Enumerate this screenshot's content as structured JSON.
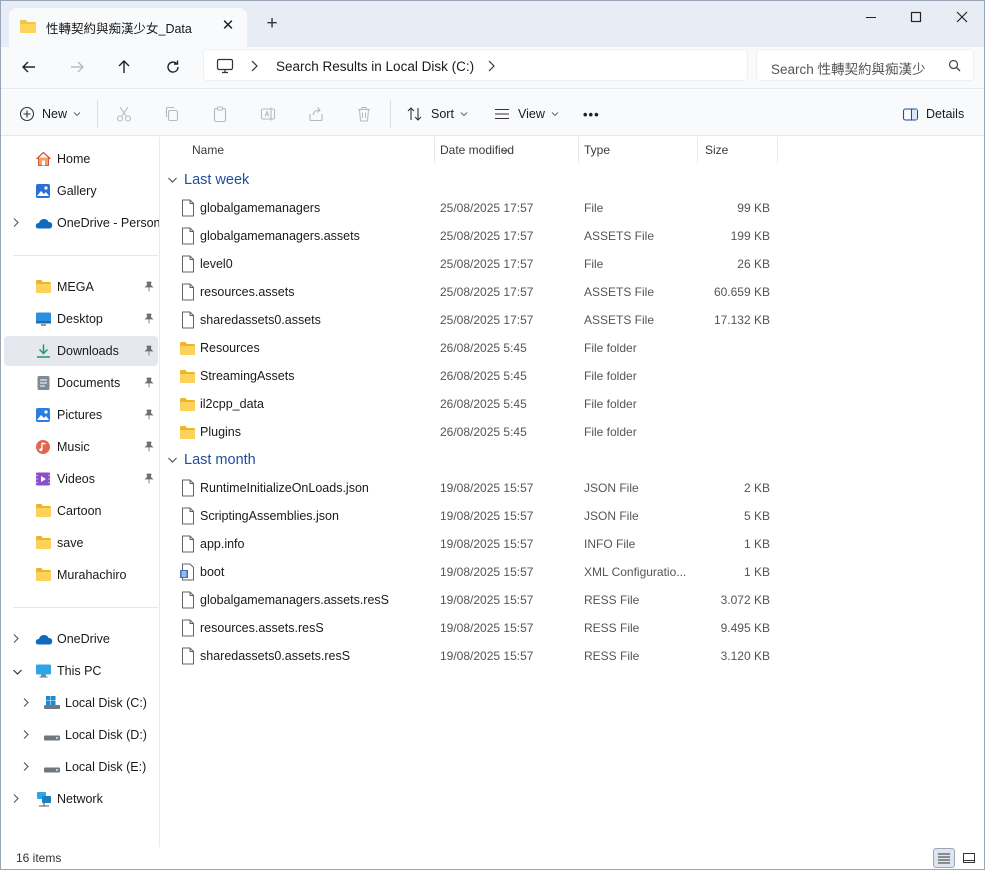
{
  "window": {
    "tab_title": "性轉契約與痴漢少女_Data",
    "tab_close": "✕",
    "new_tab": "+"
  },
  "address": {
    "breadcrumb": "Search Results in Local Disk (C:)",
    "search_placeholder": "Search 性轉契約與痴漢少"
  },
  "toolbar": {
    "new_label": "New",
    "sort_label": "Sort",
    "view_label": "View",
    "more_label": "•••",
    "details_label": "Details"
  },
  "sidebar": {
    "items": [
      {
        "label": "Home",
        "icon": "home-icon"
      },
      {
        "label": "Gallery",
        "icon": "gallery-icon"
      },
      {
        "label": "OneDrive - Persona",
        "icon": "onedrive-icon"
      },
      {
        "label": "MEGA",
        "icon": "folder-icon"
      },
      {
        "label": "Desktop",
        "icon": "desktop-icon"
      },
      {
        "label": "Downloads",
        "icon": "downloads-icon"
      },
      {
        "label": "Documents",
        "icon": "documents-icon"
      },
      {
        "label": "Pictures",
        "icon": "pictures-icon"
      },
      {
        "label": "Music",
        "icon": "music-icon"
      },
      {
        "label": "Videos",
        "icon": "videos-icon"
      },
      {
        "label": "Cartoon",
        "icon": "folder-icon"
      },
      {
        "label": "save",
        "icon": "folder-icon"
      },
      {
        "label": "Murahachiro",
        "icon": "folder-icon"
      },
      {
        "label": "OneDrive",
        "icon": "onedrive-icon"
      },
      {
        "label": "This PC",
        "icon": "pc-icon"
      },
      {
        "label": "Local Disk (C:)",
        "icon": "windows-drive-icon"
      },
      {
        "label": "Local Disk (D:)",
        "icon": "drive-icon"
      },
      {
        "label": "Local Disk (E:)",
        "icon": "drive-icon"
      },
      {
        "label": "Network",
        "icon": "network-icon"
      }
    ]
  },
  "columns": {
    "name": "Name",
    "date": "Date modified",
    "type": "Type",
    "size": "Size"
  },
  "groups": [
    {
      "label": "Last week",
      "files": [
        {
          "name": "globalgamemanagers",
          "date": "25/08/2025 17:57",
          "type": "File",
          "size": "99 KB",
          "icon": "file-icon"
        },
        {
          "name": "globalgamemanagers.assets",
          "date": "25/08/2025 17:57",
          "type": "ASSETS File",
          "size": "199 KB",
          "icon": "file-icon"
        },
        {
          "name": "level0",
          "date": "25/08/2025 17:57",
          "type": "File",
          "size": "26 KB",
          "icon": "file-icon"
        },
        {
          "name": "resources.assets",
          "date": "25/08/2025 17:57",
          "type": "ASSETS File",
          "size": "60.659 KB",
          "icon": "file-icon"
        },
        {
          "name": "sharedassets0.assets",
          "date": "25/08/2025 17:57",
          "type": "ASSETS File",
          "size": "17.132 KB",
          "icon": "file-icon"
        },
        {
          "name": "Resources",
          "date": "26/08/2025 5:45",
          "type": "File folder",
          "size": "",
          "icon": "folder-icon"
        },
        {
          "name": "StreamingAssets",
          "date": "26/08/2025 5:45",
          "type": "File folder",
          "size": "",
          "icon": "folder-icon"
        },
        {
          "name": "il2cpp_data",
          "date": "26/08/2025 5:45",
          "type": "File folder",
          "size": "",
          "icon": "folder-icon"
        },
        {
          "name": "Plugins",
          "date": "26/08/2025 5:45",
          "type": "File folder",
          "size": "",
          "icon": "folder-icon"
        }
      ]
    },
    {
      "label": "Last month",
      "files": [
        {
          "name": "RuntimeInitializeOnLoads.json",
          "date": "19/08/2025 15:57",
          "type": "JSON File",
          "size": "2 KB",
          "icon": "file-icon"
        },
        {
          "name": "ScriptingAssemblies.json",
          "date": "19/08/2025 15:57",
          "type": "JSON File",
          "size": "5 KB",
          "icon": "file-icon"
        },
        {
          "name": "app.info",
          "date": "19/08/2025 15:57",
          "type": "INFO File",
          "size": "1 KB",
          "icon": "file-icon"
        },
        {
          "name": "boot",
          "date": "19/08/2025 15:57",
          "type": "XML Configuratio...",
          "size": "1 KB",
          "icon": "config-file-icon"
        },
        {
          "name": "globalgamemanagers.assets.resS",
          "date": "19/08/2025 15:57",
          "type": "RESS File",
          "size": "3.072 KB",
          "icon": "file-icon"
        },
        {
          "name": "resources.assets.resS",
          "date": "19/08/2025 15:57",
          "type": "RESS File",
          "size": "9.495 KB",
          "icon": "file-icon"
        },
        {
          "name": "sharedassets0.assets.resS",
          "date": "19/08/2025 15:57",
          "type": "RESS File",
          "size": "3.120 KB",
          "icon": "file-icon"
        }
      ]
    }
  ],
  "status": {
    "item_count": "16 items"
  },
  "colors": {
    "accent": "#1f4e9a",
    "folder": "#f5c342",
    "selected": "#e5e8ee"
  }
}
